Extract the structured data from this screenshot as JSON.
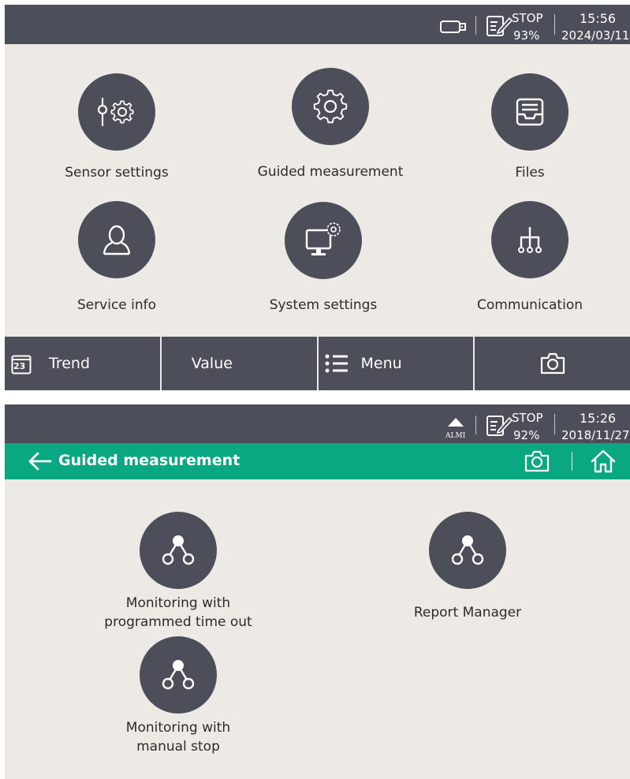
{
  "screen1": {
    "status": {
      "stop": "STOP",
      "battery": "93%",
      "time": "15:56",
      "date": "2024/03/11"
    },
    "tiles": [
      {
        "label": "Sensor settings",
        "icon": "sensor-gear-icon"
      },
      {
        "label": "Guided measurement",
        "icon": "gear-icon"
      },
      {
        "label": "Files",
        "icon": "file-tray-icon"
      },
      {
        "label": "Service info",
        "icon": "person-icon"
      },
      {
        "label": "System settings",
        "icon": "monitor-gear-icon"
      },
      {
        "label": "Communication",
        "icon": "network-tree-icon"
      }
    ],
    "bottom_bar": {
      "trend_day": "23",
      "trend": "Trend",
      "value": "Value",
      "menu": "Menu",
      "camera_icon": "camera-icon"
    }
  },
  "screen2": {
    "status": {
      "alarm": "ALMI",
      "stop": "STOP",
      "battery": "92%",
      "time": "15:26",
      "date": "2018/11/27"
    },
    "header": {
      "title": "Guided measurement",
      "back_icon": "back-arrow-icon",
      "camera_icon": "camera-icon",
      "home_icon": "home-icon"
    },
    "items": [
      {
        "label_line1": "Monitoring with",
        "label_line2": "programmed time out",
        "icon": "workflow-icon"
      },
      {
        "label_line1": "Report Manager",
        "label_line2": "",
        "icon": "workflow-icon"
      },
      {
        "label_line1": "Monitoring with",
        "label_line2": "manual stop",
        "icon": "workflow-icon"
      }
    ]
  },
  "colors": {
    "bar": "#4c4e5a",
    "accent": "#0aa882",
    "background": "#edeae6"
  }
}
